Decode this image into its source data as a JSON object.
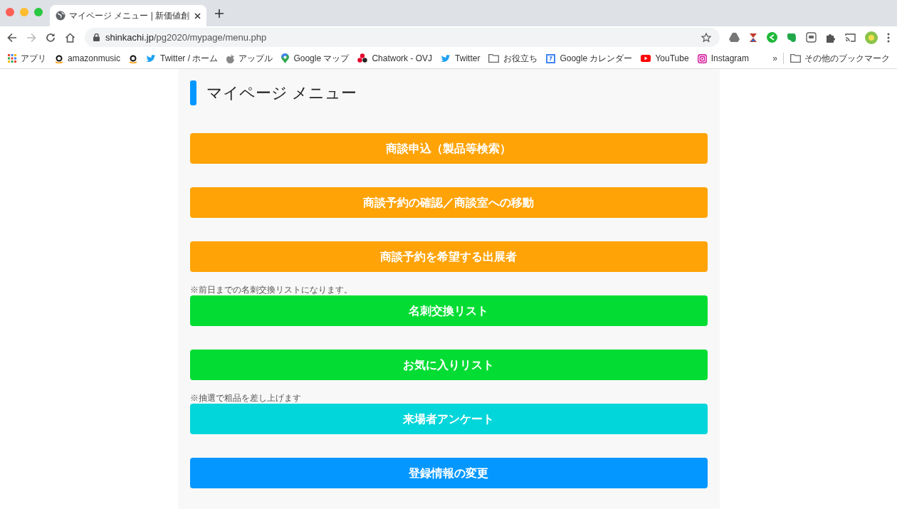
{
  "browser": {
    "tab": {
      "title": "マイページ メニュー | 新価値創"
    },
    "url": {
      "host": "shinkachi.jp",
      "path": "/pg2020/mypage/menu.php"
    },
    "bookmarks": [
      {
        "kind": "apps",
        "label": "アプリ"
      },
      {
        "kind": "amazon",
        "label": "amazonmusic"
      },
      {
        "kind": "amazon"
      },
      {
        "kind": "bird",
        "label": "Twitter / ホーム"
      },
      {
        "kind": "apple",
        "label": "アップル"
      },
      {
        "kind": "pin",
        "label": "Google マップ"
      },
      {
        "kind": "flower",
        "label": "Chatwork - OVJ"
      },
      {
        "kind": "bird",
        "label": "Twitter"
      },
      {
        "kind": "folder",
        "label": "お役立ち"
      },
      {
        "kind": "calendar",
        "label": "Google カレンダー"
      },
      {
        "kind": "play",
        "label": "YouTube"
      },
      {
        "kind": "camera",
        "label": "Instagram"
      }
    ],
    "more": "»",
    "other_bookmarks": "その他のブックマーク"
  },
  "page": {
    "title": "マイページ メニュー",
    "menu": [
      {
        "label": "商談申込（製品等検索）",
        "color": "#ffa306"
      },
      {
        "label": "商談予約の確認／商談室への移動",
        "color": "#ffa306"
      },
      {
        "label": "商談予約を希望する出展者",
        "color": "#ffa306"
      },
      {
        "label": "名刺交換リスト",
        "color": "#03dd33",
        "note": "※前日までの名刺交換リストになります。"
      },
      {
        "label": "お気に入りリスト",
        "color": "#03dd33"
      },
      {
        "label": "来場者アンケート",
        "color": "#03d6da",
        "note": "※抽選で粗品を差し上げます"
      },
      {
        "label": "登録情報の変更",
        "color": "#0497ff"
      }
    ]
  }
}
